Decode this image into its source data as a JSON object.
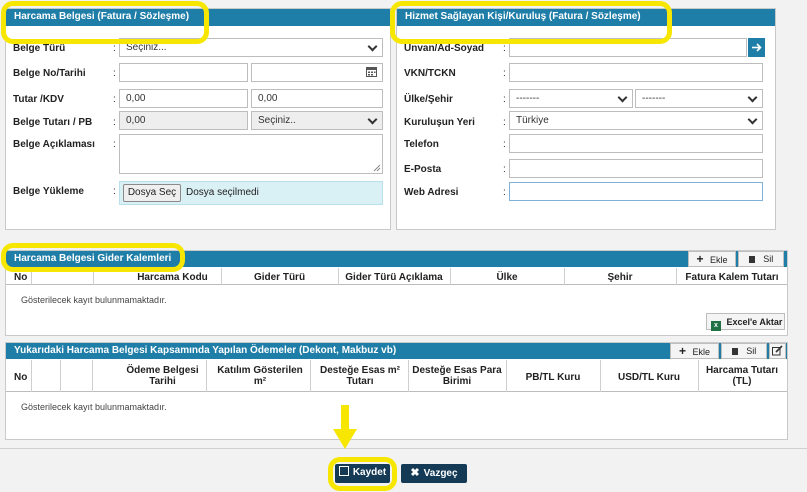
{
  "left_panel": {
    "title": "Harcama Belgesi (Fatura / Sözleşme)",
    "fields": {
      "belge_turu": {
        "label": "Belge Türü",
        "value": "Seçiniz..."
      },
      "belge_no_tarihi": {
        "label": "Belge No/Tarihi",
        "value": "",
        "date_value": ""
      },
      "tutar_kdv": {
        "label": "Tutar /KDV",
        "tutar": "0,00",
        "kdv": "0,00"
      },
      "belge_tutari_pb": {
        "label": "Belge Tutarı / PB",
        "tutar": "0,00",
        "pb": "Seçiniz.."
      },
      "belge_aciklamasi": {
        "label": "Belge Açıklaması",
        "value": ""
      },
      "belge_yukleme": {
        "label": "Belge Yükleme",
        "button": "Dosya Seç",
        "status": "Dosya seçilmedi"
      }
    }
  },
  "right_panel": {
    "title": "Hizmet Sağlayan Kişi/Kuruluş (Fatura / Sözleşme)",
    "fields": {
      "unvan": {
        "label": "Unvan/Ad-Soyad",
        "value": ""
      },
      "vkn": {
        "label": "VKN/TCKN",
        "value": ""
      },
      "ulke_sehir": {
        "label": "Ülke/Şehir",
        "ulke": "-------",
        "sehir": "-------"
      },
      "kurulus_yeri": {
        "label": "Kuruluşun Yeri",
        "value": "Türkiye"
      },
      "telefon": {
        "label": "Telefon",
        "value": ""
      },
      "eposta": {
        "label": "E-Posta",
        "value": ""
      },
      "web": {
        "label": "Web Adresi",
        "value": ""
      }
    }
  },
  "colon": ":",
  "gider_table": {
    "title": "Harcama Belgesi Gider Kalemleri",
    "add_label": "Ekle",
    "delete_label": "Sil",
    "columns": [
      "No",
      "",
      "Harcama Kodu",
      "Gider Türü",
      "Gider Türü Açıklama",
      "Ülke",
      "Şehir",
      "Fatura Kalem Tutarı"
    ],
    "empty_text": "Gösterilecek kayıt bulunmamaktadır.",
    "export_label": "Excel'e Aktar"
  },
  "odeme_table": {
    "title": "Yukarıdaki Harcama Belgesi Kapsamında Yapılan Ödemeler (Dekont, Makbuz vb)",
    "add_label": "Ekle",
    "delete_label": "Sil",
    "columns": [
      "No",
      "",
      "",
      "Ödeme Belgesi Tarihi",
      "Katılım Gösterilen m²",
      "Desteğe Esas m² Tutarı",
      "Desteğe Esas Para Birimi",
      "PB/TL Kuru",
      "USD/TL Kuru",
      "Harcama Tutarı (TL)"
    ],
    "empty_text": "Gösterilecek kayıt bulunmamaktadır."
  },
  "footer": {
    "save_label": "Kaydet",
    "cancel_label": "Vazgeç"
  },
  "colors": {
    "header_blue": "#1f7ea8",
    "highlight_yellow": "#f6e600",
    "navy_button": "#143a56",
    "upload_bg": "#d9f0f5"
  }
}
